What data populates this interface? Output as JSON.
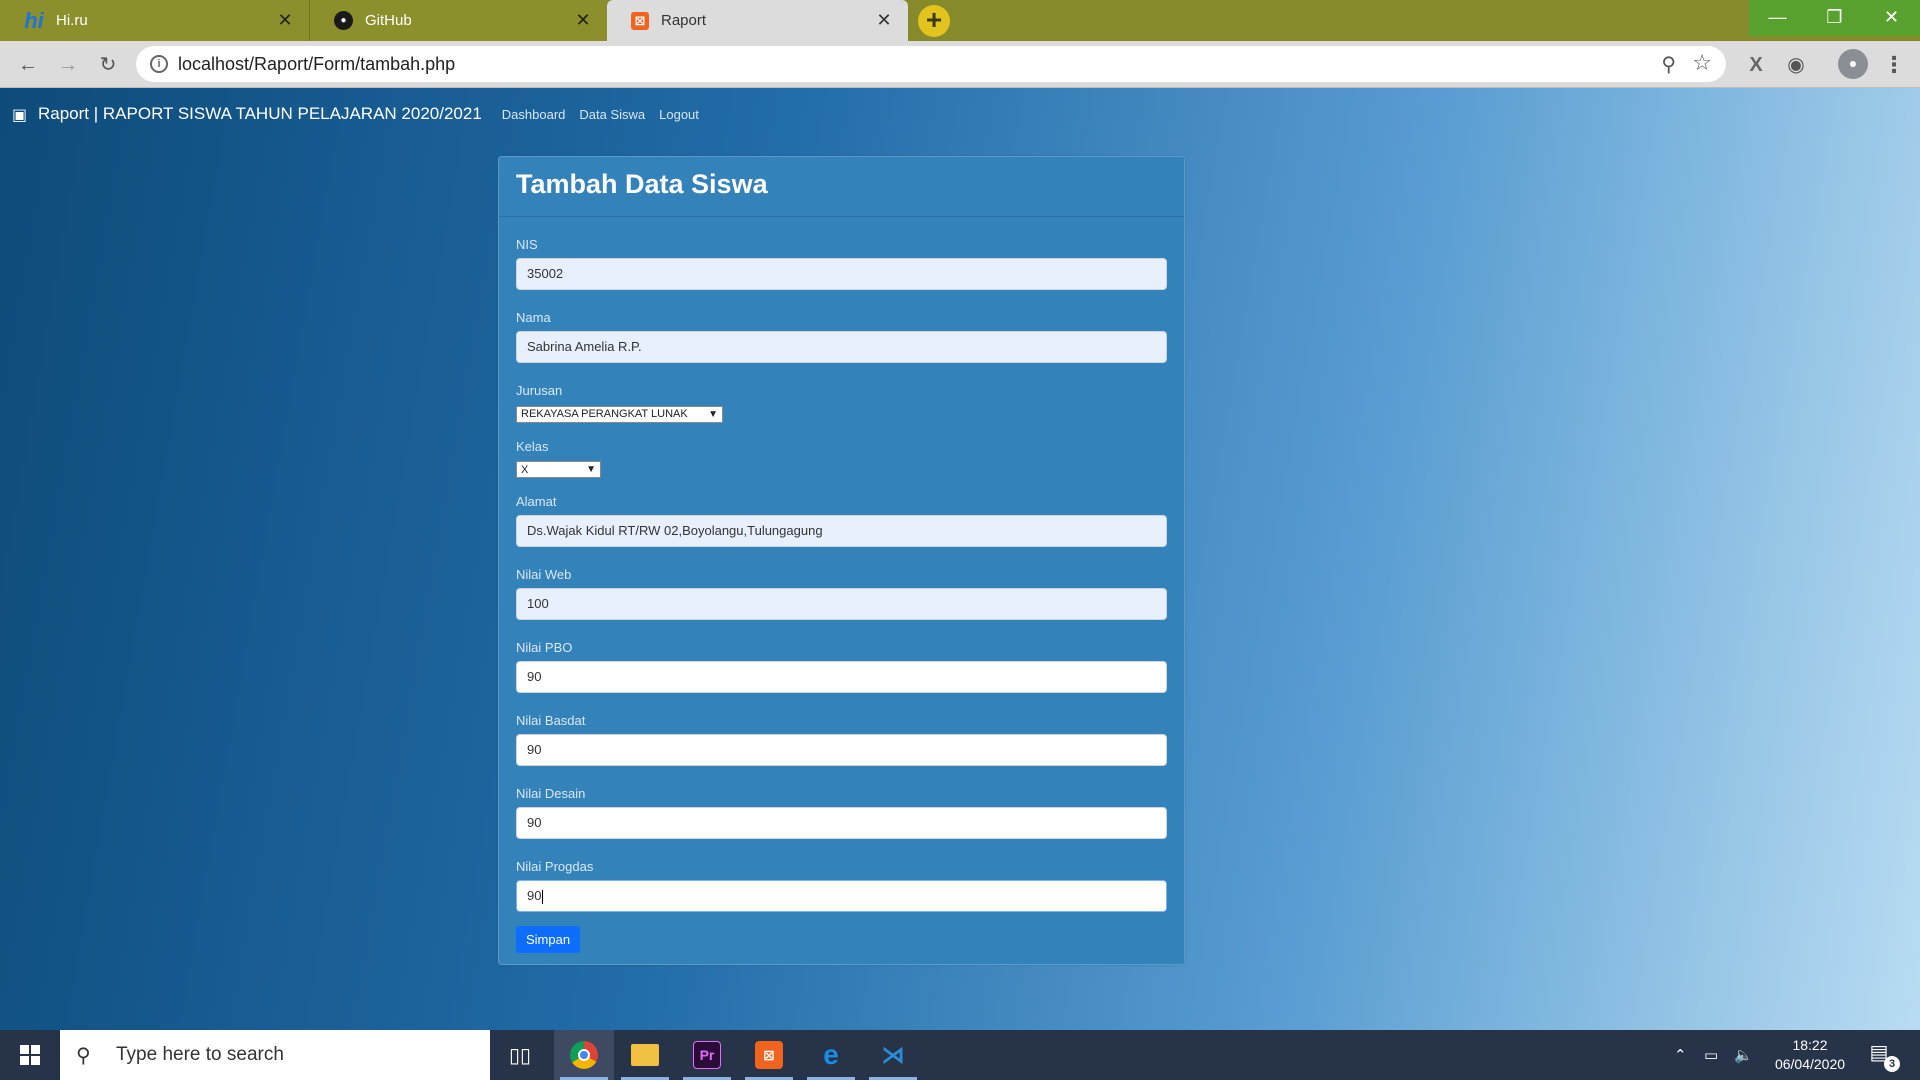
{
  "browser": {
    "tabs": [
      {
        "title": "Hi.ru",
        "icon": "hi-ru-icon",
        "active": false
      },
      {
        "title": "GitHub",
        "icon": "github-icon",
        "active": false
      },
      {
        "title": "Raport",
        "icon": "xampp-icon",
        "active": true
      }
    ],
    "url": "localhost/Raport/Form/tambah.php"
  },
  "navbar": {
    "brand": "Raport | RAPORT SISWA TAHUN PELAJARAN 2020/2021",
    "links": [
      "Dashboard",
      "Data Siswa",
      "Logout"
    ]
  },
  "form": {
    "title": "Tambah Data Siswa",
    "nis": {
      "label": "NIS",
      "value": "35002"
    },
    "nama": {
      "label": "Nama",
      "value": "Sabrina Amelia R.P."
    },
    "jurusan": {
      "label": "Jurusan",
      "value": "REKAYASA PERANGKAT LUNAK"
    },
    "kelas": {
      "label": "Kelas",
      "value": "X"
    },
    "alamat": {
      "label": "Alamat",
      "value": "Ds.Wajak Kidul RT/RW 02,Boyolangu,Tulungagung"
    },
    "nilai_web": {
      "label": "Nilai Web",
      "value": "100"
    },
    "nilai_pbo": {
      "label": "Nilai PBO",
      "value": "90"
    },
    "nilai_basdat": {
      "label": "Nilai Basdat",
      "value": "90"
    },
    "nilai_desain": {
      "label": "Nilai Desain",
      "value": "90"
    },
    "nilai_progdas": {
      "label": "Nilai Progdas",
      "value": "90"
    },
    "submit": "Simpan"
  },
  "taskbar": {
    "search_placeholder": "Type here to search",
    "time": "18:22",
    "date": "06/04/2020",
    "notifications": "3"
  },
  "colors": {
    "tab_strip": "#868a2a",
    "accent_button": "#0d6efd",
    "card": "#3382ba"
  }
}
